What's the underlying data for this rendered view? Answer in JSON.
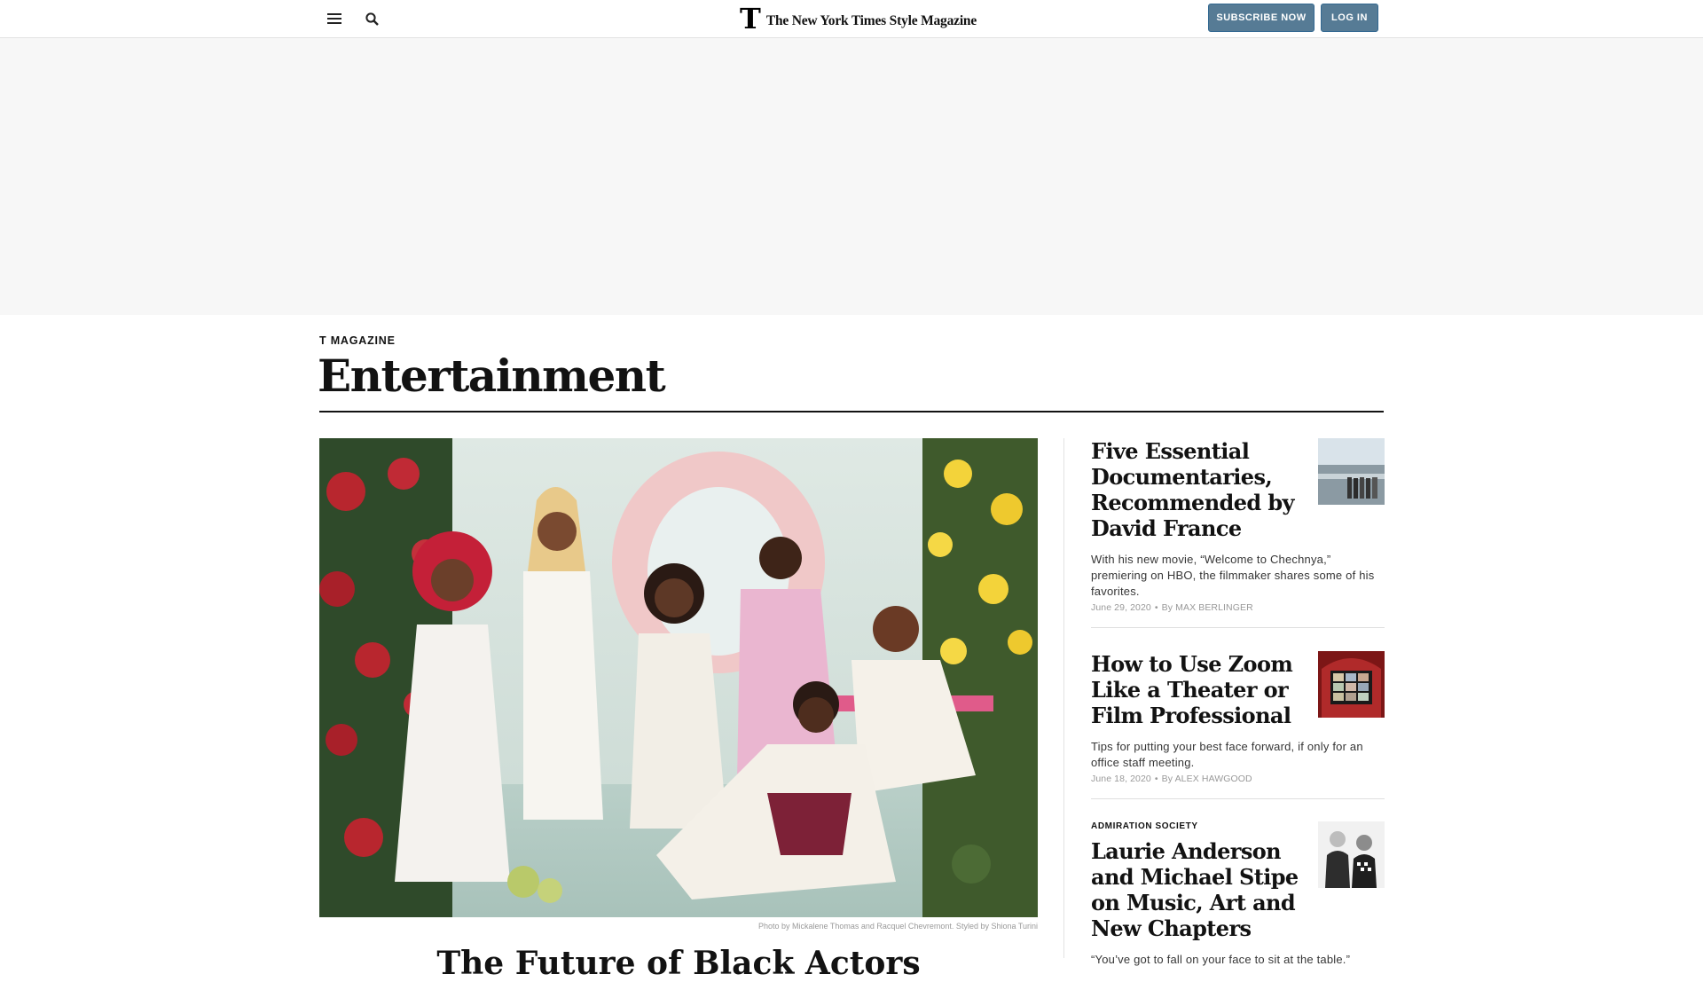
{
  "header": {
    "menu_icon": "hamburger-menu-icon",
    "search_icon": "search-icon",
    "logo_mark": "T",
    "logo_text": "The New York Times Style Magazine",
    "subscribe_label": "SUBSCRIBE NOW",
    "login_label": "LOG IN",
    "button_color": "#567b95"
  },
  "section": {
    "kicker": "T MAGAZINE",
    "title": "Entertainment"
  },
  "lead": {
    "photo_credit": "Photo by Mickalene Thomas and Racquel Chevremont. Styled by Shiona Turini",
    "headline": "The Future of Black Actors"
  },
  "stories": [
    {
      "kicker": "",
      "headline": "Five Essential Documentaries, Recommended by David France",
      "summary": "With his new movie, “Welcome to Chechnya,” premiering on HBO, the filmmaker shares some of his favorites.",
      "date": "June 29, 2020",
      "byline_prefix": "By",
      "byline": "MAX BERLINGER"
    },
    {
      "kicker": "",
      "headline": "How to Use Zoom Like a Theater or Film Professional",
      "summary": "Tips for putting your best face forward, if only for an office staff meeting.",
      "date": "June 18, 2020",
      "byline_prefix": "By",
      "byline": "ALEX HAWGOOD"
    },
    {
      "kicker": "ADMIRATION SOCIETY",
      "headline": "Laurie Anderson and Michael Stipe on Music, Art and New Chapters",
      "summary": "“You’ve got to fall on your face to sit at the table.”",
      "date": "",
      "byline_prefix": "",
      "byline": ""
    }
  ]
}
